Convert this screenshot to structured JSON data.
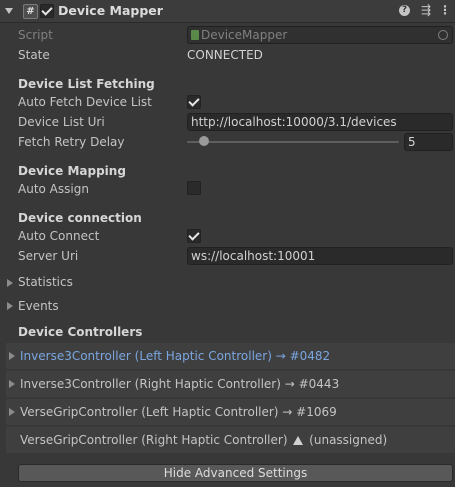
{
  "header": {
    "title": "Device Mapper",
    "component_icon": "hash-icon",
    "help_icon": "help-icon",
    "settings_icon": "sliders-icon",
    "menu_icon": "kebab-menu-icon",
    "enabled": true
  },
  "fields": {
    "script_label": "Script",
    "script_value": "DeviceMapper",
    "state_label": "State",
    "state_value": "CONNECTED"
  },
  "fetching": {
    "title": "Device List Fetching",
    "auto_fetch_label": "Auto Fetch Device List",
    "auto_fetch": true,
    "uri_label": "Device List Uri",
    "uri_value": "http://localhost:10000/3.1/devices",
    "retry_label": "Fetch Retry Delay",
    "retry_value": "5"
  },
  "mapping": {
    "title": "Device Mapping",
    "auto_assign_label": "Auto Assign",
    "auto_assign": false
  },
  "connection": {
    "title": "Device connection",
    "auto_connect_label": "Auto Connect",
    "auto_connect": true,
    "server_label": "Server Uri",
    "server_value": "ws://localhost:10001"
  },
  "foldouts": {
    "statistics": "Statistics",
    "events": "Events"
  },
  "controllers": {
    "title": "Device Controllers",
    "items": [
      {
        "label": "Inverse3Controller (Left Haptic Controller) → #0482",
        "selected": true
      },
      {
        "label": "Inverse3Controller (Right Haptic Controller) → #0443",
        "selected": false
      },
      {
        "label": "VerseGripController (Left Haptic Controller) → #1069",
        "selected": false
      },
      {
        "label_pre": "VerseGripController (Right Haptic Controller)",
        "label_post": "(unassigned)",
        "warning_icon": "warning-icon"
      }
    ]
  },
  "buttons": {
    "advanced": "Hide Advanced Settings"
  },
  "colors": {
    "background": "#383838",
    "selected_text": "#7aa6e0",
    "row_background": "#3f3f3f"
  }
}
